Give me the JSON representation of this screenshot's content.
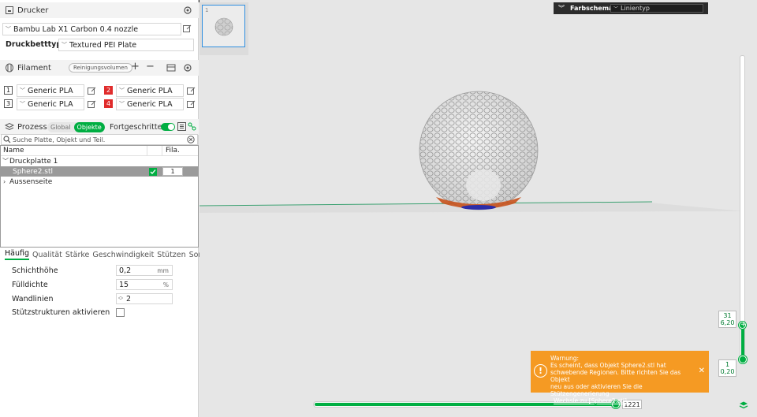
{
  "printer": {
    "header": "Drucker",
    "name": "Bambu Lab X1 Carbon 0.4 nozzle",
    "bed_label": "Druckbetttyp",
    "bed_type": "Textured PEI Plate"
  },
  "filament": {
    "header": "Filament",
    "flush_button": "Reinigungsvolumen",
    "slots": [
      {
        "num": "1",
        "name": "Generic PLA",
        "style": "outline"
      },
      {
        "num": "2",
        "name": "Generic PLA",
        "style": "red"
      },
      {
        "num": "3",
        "name": "Generic PLA",
        "style": "outline"
      },
      {
        "num": "4",
        "name": "Generic PLA",
        "style": "red"
      }
    ]
  },
  "process": {
    "header": "Prozess",
    "toggle_global": "Global",
    "toggle_objects": "Objekte",
    "advanced_label": "Fortgeschritten",
    "search_placeholder": "Suche Platte, Objekt und Teil.",
    "columns": {
      "name": "Name",
      "fila": "Fila."
    },
    "tree": {
      "plate": "Druckplatte 1",
      "object": "Sphere2.stl",
      "object_fila": "1",
      "outside": "Aussenseite"
    },
    "tabs": [
      "Häufig",
      "Qualität",
      "Stärke",
      "Geschwindigkeit",
      "Stützen",
      "Sonstige"
    ],
    "params": {
      "layer_height": {
        "label": "Schichthöhe",
        "value": "0,2",
        "unit": "mm"
      },
      "infill": {
        "label": "Fülldichte",
        "value": "15",
        "unit": "%"
      },
      "walls": {
        "label": "Wandlinien",
        "value": "2"
      },
      "supports": {
        "label": "Stützstrukturen aktivieren"
      }
    }
  },
  "viewport": {
    "thumb_index": "1",
    "color_scheme_label": "Farbschema",
    "color_scheme_value": "Linientyp",
    "layer_top": {
      "layer": "31",
      "height": "6,20"
    },
    "layer_bottom": {
      "layer": "1",
      "height": "0,20"
    },
    "moves_value": "1221"
  },
  "warning": {
    "title": "Warnung:",
    "line1": "Es scheint, dass Objekt Sphere2.stl hat",
    "line2": "schwebende Regionen. Bitte richten Sie das Objekt",
    "line3": "neu aus oder aktivieren Sie die Stützengenerierung",
    "link": "Wechsle zu [Sphere2.stl]"
  },
  "colors": {
    "accent": "#00ae42",
    "warning": "#f59a23",
    "slot_red": "#e02c2c",
    "selection": "#2f8fe0"
  }
}
